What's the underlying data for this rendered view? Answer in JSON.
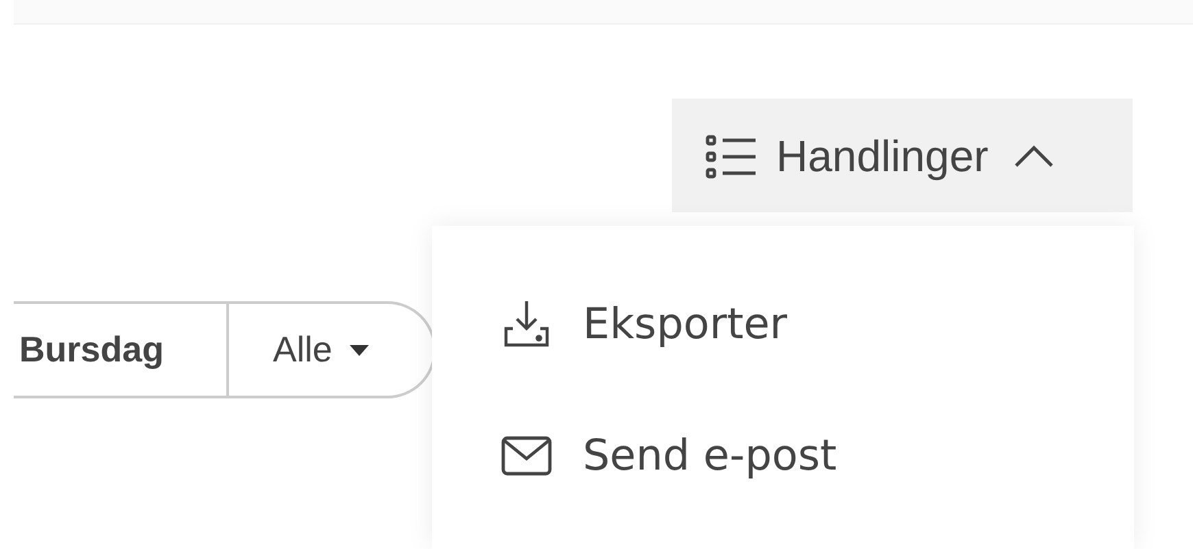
{
  "actions_button": {
    "label": "Handlinger",
    "expanded": true
  },
  "filter": {
    "field": "Bursdag",
    "value": "Alle"
  },
  "menu": {
    "items": [
      {
        "label": "Eksporter",
        "kind": "export"
      },
      {
        "label": "Send e-post",
        "kind": "email"
      }
    ]
  }
}
